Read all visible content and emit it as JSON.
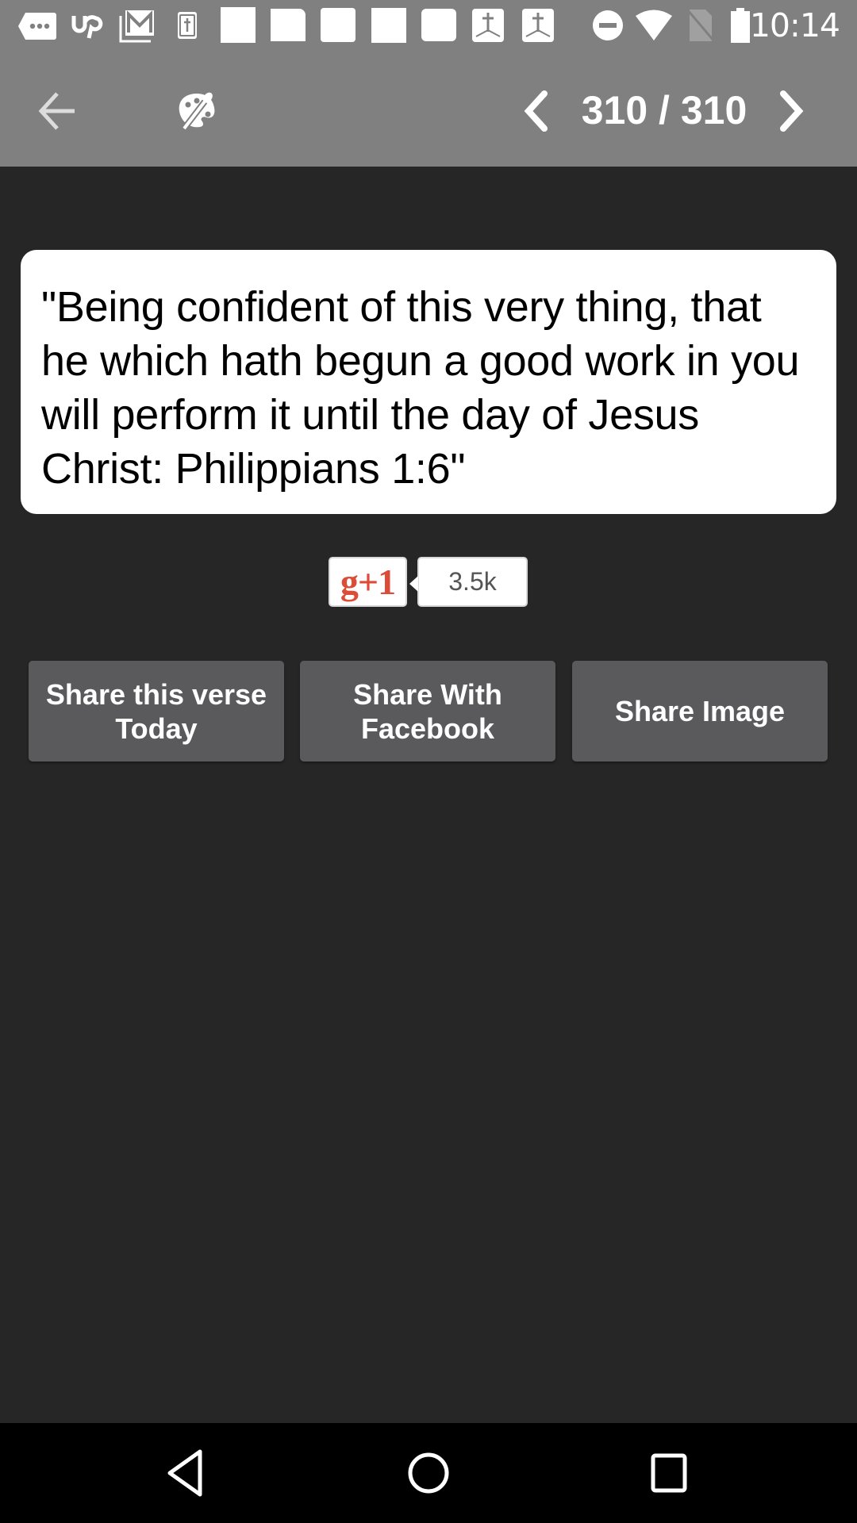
{
  "status_bar": {
    "time": "10:14",
    "left_icons": [
      "messaging-icon",
      "upwork-icon",
      "gmail-icon",
      "bible-app-icon",
      "blank-notification-icon",
      "blank-notification-icon",
      "blank-notification-icon",
      "blank-notification-icon",
      "blank-notification-icon",
      "bible-cross-icon",
      "bible-cross-icon"
    ],
    "right_icons": [
      "do-not-disturb-icon",
      "wifi-icon",
      "no-sim-icon",
      "battery-icon"
    ]
  },
  "header": {
    "back_icon": "arrow-left-icon",
    "theme_icon": "palette-icon",
    "prev_icon": "chevron-left-icon",
    "next_icon": "chevron-right-icon",
    "current_page": "310",
    "total_pages": "310",
    "page_counter": "310 / 310"
  },
  "verse": {
    "text": "\"Being confident of this very thing, that he which hath begun a good work in you will perform it until the day of Jesus Christ: Philippians 1:6\""
  },
  "gplus": {
    "label": "g+1",
    "count": "3.5k",
    "brand_color": "#dd4b39"
  },
  "share_buttons": [
    {
      "label_line1": "Share this verse",
      "label_line2": "Today"
    },
    {
      "label_line1": "Share With",
      "label_line2": "Facebook"
    },
    {
      "label_line1": "Share Image",
      "label_line2": ""
    }
  ],
  "nav_bar": {
    "back_icon": "nav-back-icon",
    "home_icon": "nav-home-icon",
    "recents_icon": "nav-recents-icon"
  },
  "colors": {
    "header_bg": "#808080",
    "body_bg": "#262626",
    "button_bg": "#5a5a5c",
    "card_bg": "#ffffff"
  }
}
